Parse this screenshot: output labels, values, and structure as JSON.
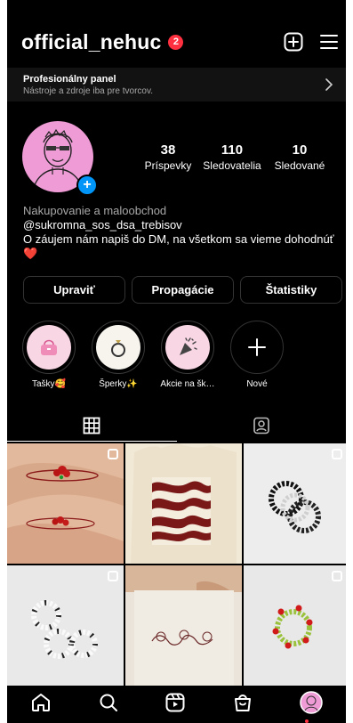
{
  "header": {
    "username": "official_nehuc",
    "notification_count": "2"
  },
  "pro_panel": {
    "title": "Profesionálny panel",
    "subtitle": "Nástroje a zdroje iba pre tvorcov."
  },
  "stats": [
    {
      "value": "38",
      "label": "Príspevky"
    },
    {
      "value": "110",
      "label": "Sledovatelia"
    },
    {
      "value": "10",
      "label": "Sledované"
    }
  ],
  "bio": {
    "category": "Nakupovanie a maloobchod",
    "handle": "@sukromna_sos_dsa_trebisov",
    "text": "O záujem nám napiš do DM, na všetkom sa vieme dohodnúť ❤️"
  },
  "buttons": {
    "edit": "Upraviť",
    "promote": "Propagácie",
    "stats": "Štatistiky"
  },
  "highlights": [
    {
      "label": "Tašky🥰",
      "icon": "handbag"
    },
    {
      "label": "Šperky✨",
      "icon": "ring"
    },
    {
      "label": "Akcie na šk…",
      "icon": "confetti"
    },
    {
      "label": "Nové",
      "icon": "plus"
    }
  ],
  "tabs": [
    "posts-grid",
    "tagged"
  ],
  "photos": [
    {
      "subject": "ring-red-beads-on-finger",
      "multi": true
    },
    {
      "subject": "tote-bag-zebra-print",
      "multi": false
    },
    {
      "subject": "black-white-bead-rings",
      "multi": true
    },
    {
      "subject": "white-black-bead-rings",
      "multi": true
    },
    {
      "subject": "tote-bag-cat-print",
      "multi": false
    },
    {
      "subject": "green-red-bead-ring",
      "multi": true
    }
  ],
  "colors": {
    "accent_blue": "#0095f6",
    "badge_red": "#ff3040",
    "avatar_pink": "#ef9bd6"
  }
}
